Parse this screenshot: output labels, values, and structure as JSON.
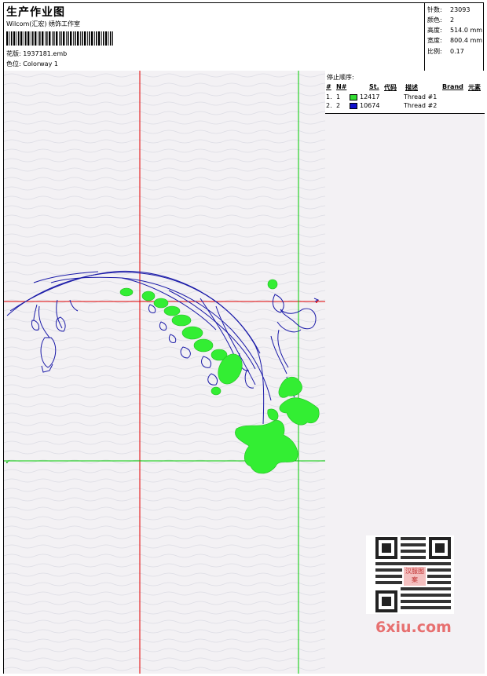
{
  "header": {
    "title": "生产作业图",
    "subtitle": "Wilcom(汇宏) 绣饰工作室",
    "design_file_label": "花版:",
    "design_file": "1937181.emb",
    "colorway_label": "色位:",
    "colorway": "Colorway 1"
  },
  "stats": [
    {
      "label": "针数:",
      "value": "23093"
    },
    {
      "label": "颜色:",
      "value": "2"
    },
    {
      "label": "高度:",
      "value": "514.0 mm"
    },
    {
      "label": "宽度:",
      "value": "800.4 mm"
    },
    {
      "label": "比例:",
      "value": "0.17"
    }
  ],
  "stop_sequence": {
    "title": "停止顺序:",
    "columns": {
      "num": "#",
      "n": "N#",
      "st": "St.",
      "code": "代码",
      "desc": "描述",
      "brand": "Brand",
      "elem": "元素"
    },
    "rows": [
      {
        "index": "1.",
        "n": "1",
        "color": "#33dd33",
        "code": "12417",
        "desc": "Thread #1"
      },
      {
        "index": "2.",
        "n": "2",
        "color": "#1010cc",
        "code": "10674",
        "desc": "Thread #2"
      }
    ]
  },
  "canvas": {
    "bg_color": "#f3f1f4",
    "guide_red": "#e00000",
    "guide_green": "#00cc00",
    "thread_green": "#33ee33",
    "thread_blue": "#1a1aa8"
  },
  "watermark": {
    "site": "6xiu.com",
    "qr_center_text": "汉服图案"
  }
}
